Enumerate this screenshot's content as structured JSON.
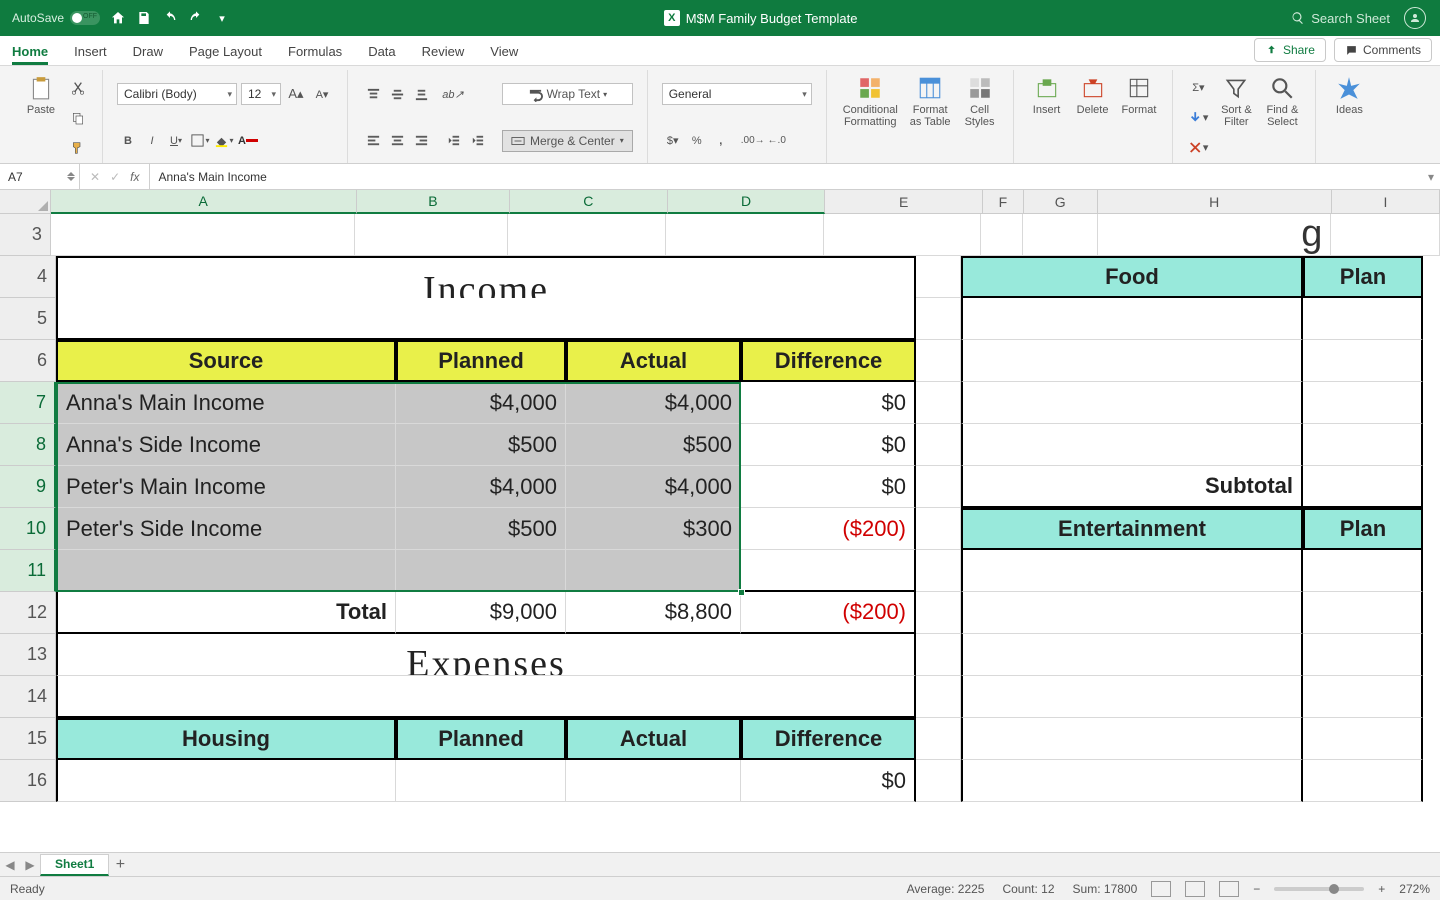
{
  "titlebar": {
    "autosave": "AutoSave",
    "doc_title": "M$M Family Budget Template",
    "search_placeholder": "Search Sheet"
  },
  "tabs": {
    "items": [
      "Home",
      "Insert",
      "Draw",
      "Page Layout",
      "Formulas",
      "Data",
      "Review",
      "View"
    ],
    "active": "Home",
    "share": "Share",
    "comments": "Comments"
  },
  "ribbon": {
    "paste": "Paste",
    "font_name": "Calibri (Body)",
    "font_size": "12",
    "wrap": "Wrap Text",
    "merge": "Merge & Center",
    "number_format": "General",
    "cond_fmt": "Conditional\nFormatting",
    "fmt_table": "Format\nas Table",
    "cell_styles": "Cell\nStyles",
    "insert": "Insert",
    "delete": "Delete",
    "format": "Format",
    "sort": "Sort &\nFilter",
    "find": "Find &\nSelect",
    "ideas": "Ideas"
  },
  "formula_bar": {
    "name_box": "A7",
    "formula": "Anna's Main Income"
  },
  "columns": [
    "A",
    "B",
    "C",
    "D",
    "E",
    "F",
    "G",
    "H",
    "I"
  ],
  "rows": [
    "3",
    "4",
    "5",
    "6",
    "7",
    "8",
    "9",
    "10",
    "11",
    "12",
    "13",
    "14",
    "15",
    "16"
  ],
  "sheet": {
    "income_title": "Income",
    "expenses_title": "Expenses",
    "hdr": {
      "source": "Source",
      "planned": "Planned",
      "actual": "Actual",
      "diff": "Difference",
      "housing": "Housing",
      "food": "Food",
      "plan": "Plan",
      "entertainment": "Entertainment",
      "subtotal": "Subtotal"
    },
    "income": [
      {
        "source": "Anna's Main Income",
        "planned": "$4,000",
        "actual": "$4,000",
        "diff": "$0"
      },
      {
        "source": "Anna's Side Income",
        "planned": "$500",
        "actual": "$500",
        "diff": "$0"
      },
      {
        "source": "Peter's Main Income",
        "planned": "$4,000",
        "actual": "$4,000",
        "diff": "$0"
      },
      {
        "source": "Peter's Side Income",
        "planned": "$500",
        "actual": "$300",
        "diff": "($200)"
      }
    ],
    "total_label": "Total",
    "total": {
      "planned": "$9,000",
      "actual": "$8,800",
      "diff": "($200)"
    },
    "row16_diff": "$0"
  },
  "sheet_tabs": {
    "active": "Sheet1"
  },
  "status": {
    "ready": "Ready",
    "avg_label": "Average:",
    "avg": "2225",
    "count_label": "Count:",
    "count": "12",
    "sum_label": "Sum:",
    "sum": "17800",
    "zoom": "272%"
  }
}
